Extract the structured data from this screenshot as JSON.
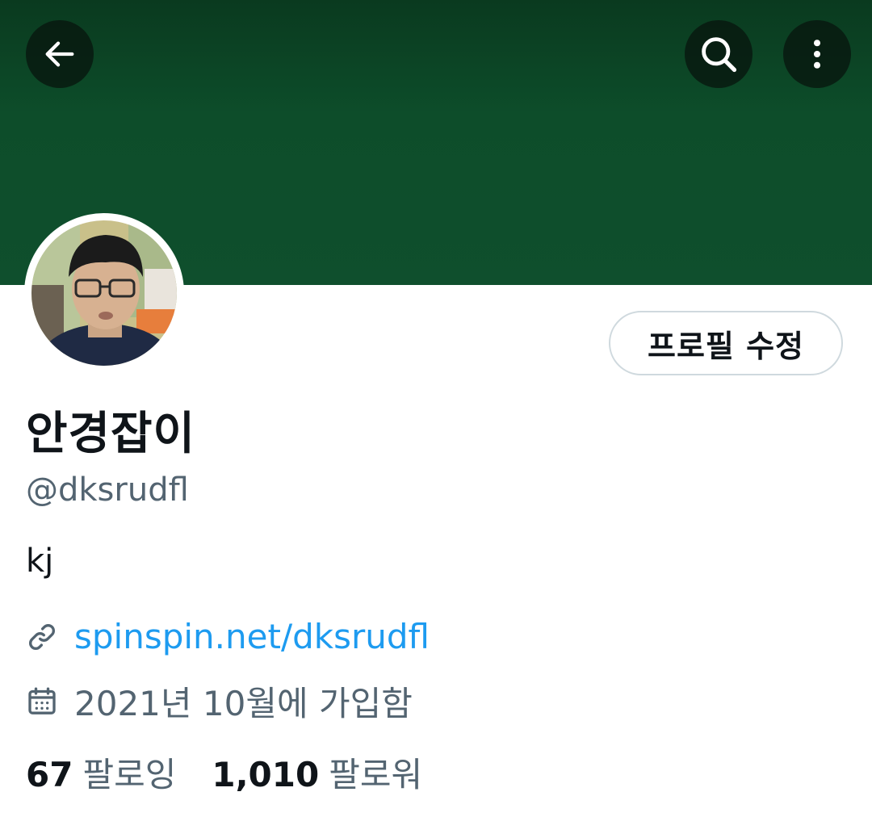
{
  "header": {
    "back_icon": "arrow-left-icon",
    "search_icon": "search-icon",
    "more_icon": "more-vertical-icon",
    "banner_color": "#0f4f2d"
  },
  "profile": {
    "edit_button_label": "프로필 수정",
    "display_name": "안경잡이",
    "handle": "@dksrudfl",
    "bio": "kj",
    "link_icon": "link-icon",
    "link_text": "spinspin.net/dksrudfl",
    "calendar_icon": "calendar-icon",
    "joined_text": "2021년 10월에 가입함",
    "following_count": "67",
    "following_label": "팔로잉",
    "followers_count": "1,010",
    "followers_label": "팔로워"
  },
  "colors": {
    "link": "#1d9bf0",
    "secondary_text": "#536471",
    "primary_text": "#0f1419"
  }
}
